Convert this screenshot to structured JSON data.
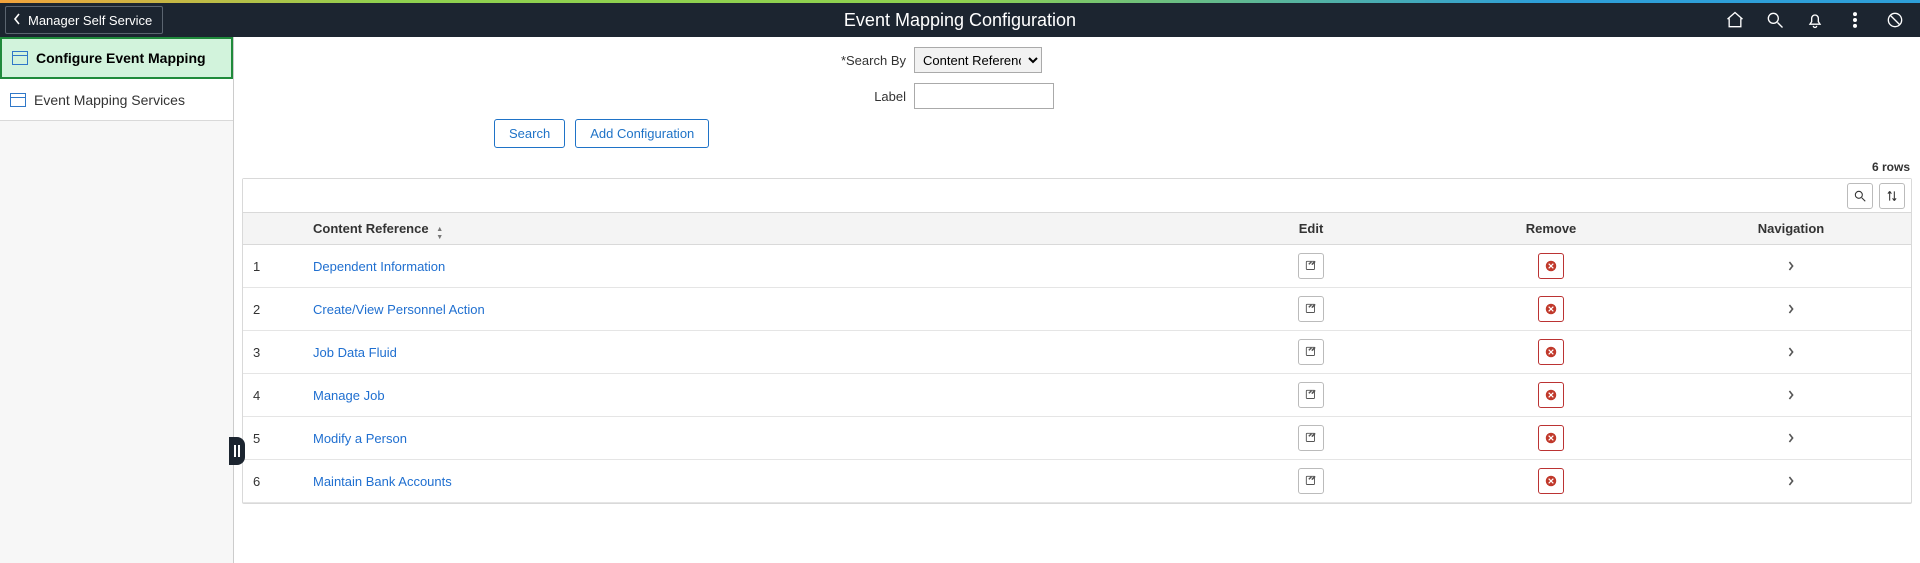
{
  "header": {
    "back_label": "Manager Self Service",
    "title": "Event Mapping Configuration"
  },
  "sidebar": {
    "items": [
      {
        "label": "Configure Event Mapping",
        "active": true
      },
      {
        "label": "Event Mapping Services",
        "active": false
      }
    ]
  },
  "form": {
    "search_by_label": "*Search By",
    "search_by_value": "Content Reference",
    "search_by_options": [
      "Content Reference"
    ],
    "label_label": "Label",
    "label_value": ""
  },
  "buttons": {
    "search": "Search",
    "add_config": "Add Configuration"
  },
  "grid": {
    "row_count_text": "6 rows",
    "columns": {
      "content_reference": "Content Reference",
      "edit": "Edit",
      "remove": "Remove",
      "navigation": "Navigation"
    },
    "rows": [
      {
        "num": "1",
        "name": "Dependent Information"
      },
      {
        "num": "2",
        "name": "Create/View Personnel Action"
      },
      {
        "num": "3",
        "name": "Job Data Fluid"
      },
      {
        "num": "4",
        "name": "Manage Job"
      },
      {
        "num": "5",
        "name": "Modify a Person"
      },
      {
        "num": "6",
        "name": "Maintain Bank Accounts"
      }
    ]
  }
}
